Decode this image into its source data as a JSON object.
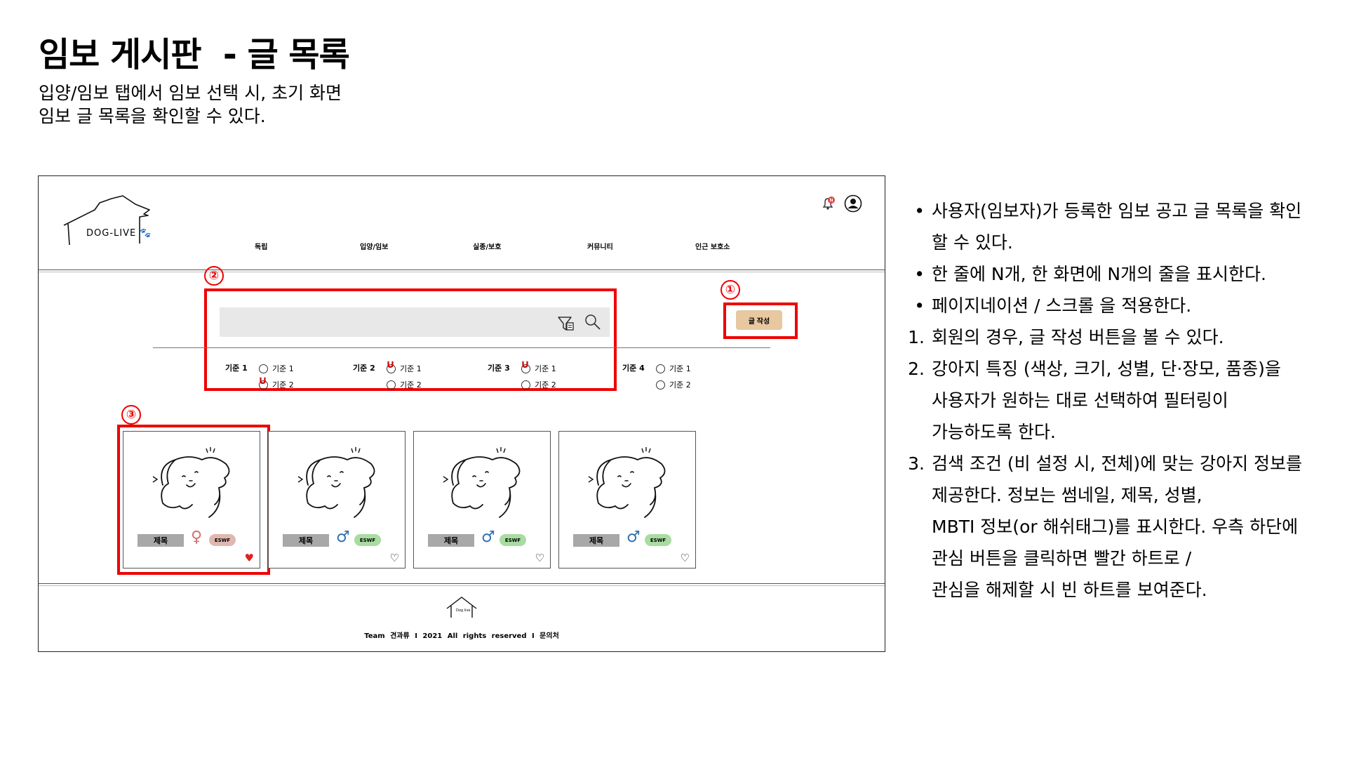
{
  "slide": {
    "title": "임보 게시판  - 글 목록",
    "description": [
      "입양/임보 탭에서 임보 선택 시, 초기 화면",
      "임보 글 목록을 확인할 수 있다."
    ]
  },
  "header": {
    "logo_text": "DOG-LIVE",
    "nav": [
      "독립",
      "입양/임보",
      "실종/보호",
      "커뮤니티",
      "인근 보호소"
    ],
    "notification_badge": "N"
  },
  "search": {
    "placeholder": "",
    "criteria": [
      {
        "label": "기준 1",
        "options": [
          "기준 1",
          "기준 2"
        ],
        "checked": 1
      },
      {
        "label": "기준 2",
        "options": [
          "기준 1",
          "기준 2"
        ],
        "checked": 0
      },
      {
        "label": "기준 3",
        "options": [
          "기준 1",
          "기준 2"
        ],
        "checked": 0
      },
      {
        "label": "기준 4",
        "options": [
          "기준 1",
          "기준 2"
        ],
        "checked": -1
      }
    ]
  },
  "write_button": "글 작성",
  "annotations": [
    "①",
    "②",
    "③"
  ],
  "cards": [
    {
      "title": "제목",
      "gender": "♀",
      "mbti": "ESWF",
      "liked": true
    },
    {
      "title": "제목",
      "gender": "♂",
      "mbti": "ESWF",
      "liked": false
    },
    {
      "title": "제목",
      "gender": "♂",
      "mbti": "ESWF",
      "liked": false
    },
    {
      "title": "제목",
      "gender": "♂",
      "mbti": "ESWF",
      "liked": false
    }
  ],
  "footer": {
    "logo_text": "Dog live",
    "text": "Team 견과류 I 2021 All rights reserved I 문의처"
  },
  "colors": {
    "accent_red": "#e00000",
    "write_button": "#e8c8a0",
    "female_mbti": "#e0b8b0",
    "male_mbti": "#a8dca0",
    "search_bar": "#e8e8e8"
  },
  "notes": {
    "bullets": [
      [
        "사용자(임보자)가 등록한 임보 공고 글 목록을 확인",
        "할 수 있다."
      ],
      [
        "한 줄에 N개, 한 화면에 N개의 줄을 표시한다."
      ],
      [
        "페이지네이션 / 스크롤 을 적용한다."
      ]
    ],
    "numbered": [
      [
        "회원의 경우, 글 작성 버튼을 볼 수 있다."
      ],
      [
        "강아지 특징 (색상, 크기, 성별, 단·장모, 품종)을",
        "사용자가 원하는 대로 선택하여 필터링이",
        "가능하도록 한다."
      ],
      [
        "검색 조건 (비 설정 시, 전체)에 맞는 강아지 정보를",
        "제공한다. 정보는 썸네일, 제목, 성별,",
        "MBTI 정보(or 해쉬태그)를 표시한다.  우측 하단에",
        "관심 버튼을 클릭하면 빨간 하트로 /",
        "관심을 해제할 시 빈 하트를 보여준다."
      ]
    ]
  }
}
